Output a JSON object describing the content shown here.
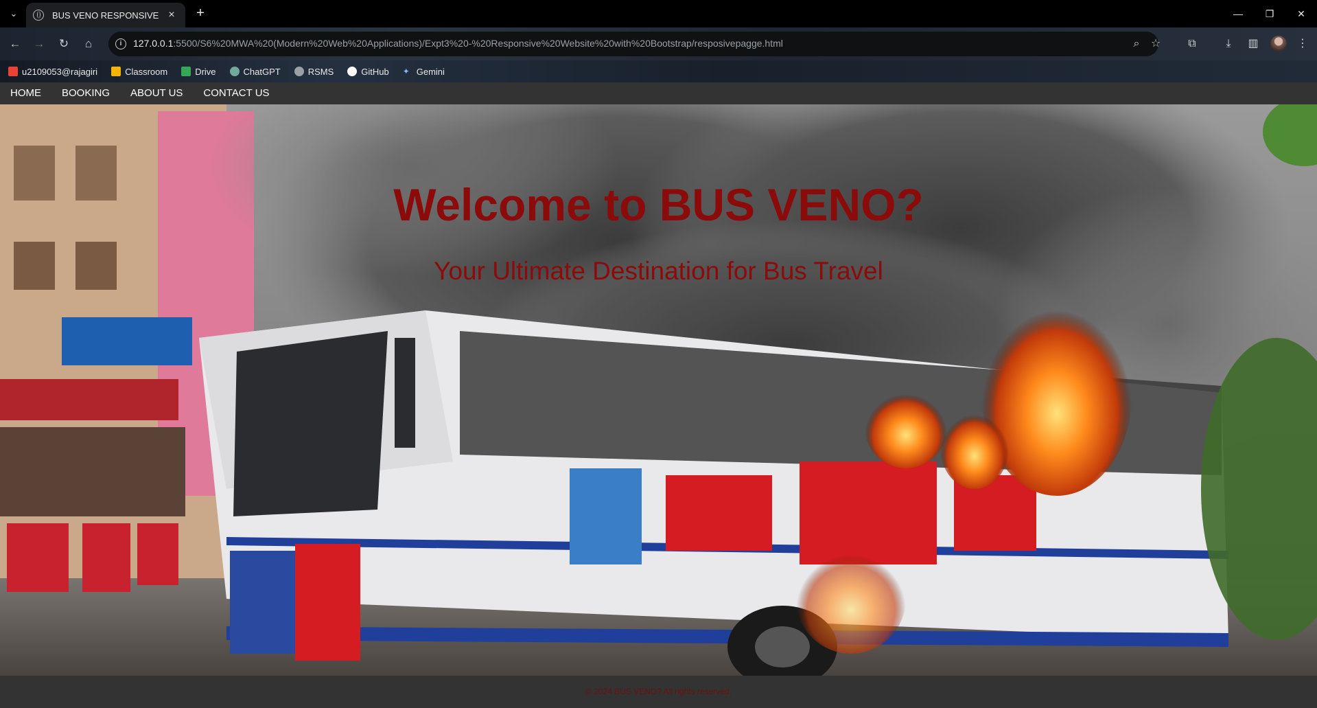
{
  "browser": {
    "tab_title": "BUS VENO RESPONSIVE",
    "url_host": "127.0.0.1",
    "url_rest": ":5500/S6%20MWA%20(Modern%20Web%20Applications)/Expt3%20-%20Responsive%20Website%20with%20Bootstrap/resposivepagge.html",
    "bookmarks": [
      {
        "label": "u2109053@rajagiri",
        "icon": "gmail-icon",
        "color": "#ea4335"
      },
      {
        "label": "Classroom",
        "icon": "classroom-icon",
        "color": "#f4b400"
      },
      {
        "label": "Drive",
        "icon": "drive-icon",
        "color": "#34a853"
      },
      {
        "label": "ChatGPT",
        "icon": "chatgpt-icon",
        "color": "#74aa9c"
      },
      {
        "label": "RSMS",
        "icon": "rsms-icon",
        "color": "#9aa0a6"
      },
      {
        "label": "GitHub",
        "icon": "github-icon",
        "color": "#ffffff"
      },
      {
        "label": "Gemini",
        "icon": "gemini-icon",
        "color": "#8ab4f8"
      }
    ]
  },
  "site": {
    "nav": [
      "HOME",
      "BOOKING",
      "ABOUT US",
      "CONTACT US"
    ],
    "hero_title": "Welcome to BUS VENO?",
    "hero_subtitle": "Your Ultimate Destination for Bus Travel",
    "footer": "© 2024 BUS VENO? All rights reserved.",
    "accent_color": "#8b0b0b",
    "nav_bg": "#333333"
  }
}
